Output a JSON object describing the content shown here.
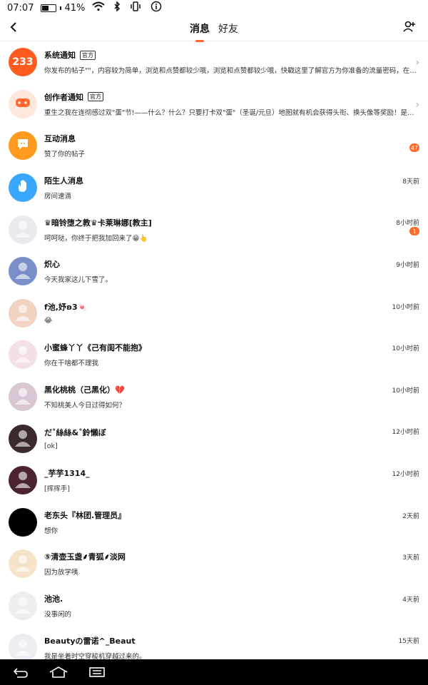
{
  "status": {
    "time": "07:07",
    "battery": "41%",
    "battery_level": 0.41
  },
  "header": {
    "tabs": [
      {
        "label": "消息"
      },
      {
        "label": "好友"
      }
    ]
  },
  "items": [
    {
      "name": "系统通知",
      "tag": "官方",
      "msg": "你发布的帖子\"\"，内容较为简单，浏览和点赞都较少哦，浏览和点赞都较少哦，快戳这里了解官方为你准备的流量密码，在成为...",
      "time": "",
      "badge": "",
      "chevron": true,
      "avatar": "233",
      "color": "#ff5b1f"
    },
    {
      "name": "创作者通知",
      "tag": "官方",
      "msg": "重生之我在连彻感过双\"蛋\"节!——什么？什么？只要打卡双\"蛋\"（圣诞/元旦）地图就有机会获得头衔、换头像等奖励！是推心动...",
      "time": "",
      "badge": "",
      "chevron": true,
      "avatar": "gamepad",
      "color": "#ffe7dc"
    },
    {
      "name": "互动消息",
      "tag": "",
      "msg": "赞了你的帖子",
      "time": "",
      "badge": "47",
      "chevron": false,
      "avatar": "chat",
      "color": "#ff9a1f"
    },
    {
      "name": "陌生人消息",
      "tag": "",
      "msg": "房间速滴",
      "time": "8天前",
      "badge": "",
      "chevron": false,
      "avatar": "hand",
      "color": "#3aa7ff"
    },
    {
      "name": "♛暗铃堕之教♛卡莱琳娜[教主]",
      "tag": "",
      "msg": "呵呵哒，你终于把我加回来了😁👆",
      "time": "8小时前",
      "badge": "1",
      "chevron": false,
      "avatar": "user",
      "color": "#e9e9ef"
    },
    {
      "name": "炽心",
      "tag": "",
      "msg": "今天我家这儿下雪了。",
      "time": "9小时前",
      "badge": "",
      "chevron": false,
      "avatar": "user",
      "color": "#7a8fc7"
    },
    {
      "name": "f池,妤ʚ3🍬",
      "tag": "",
      "msg": "😂",
      "time": "10小时前",
      "badge": "",
      "chevron": false,
      "avatar": "user",
      "color": "#f2d2c2"
    },
    {
      "name": "小蜜蜂丫丫《己有闺不能抱》",
      "tag": "",
      "msg": "你在干啥都不理我",
      "time": "10小时前",
      "badge": "",
      "chevron": false,
      "avatar": "user",
      "color": "#f3dfe6"
    },
    {
      "name": "黑化桃桃（己黑化）💔",
      "tag": "",
      "msg": "不知桃美人今日过得如何？",
      "time": "10小时前",
      "badge": "",
      "chevron": false,
      "avatar": "user",
      "color": "#d9c6d4"
    },
    {
      "name": "だ˚絲絲&˚鈴懶ぼ",
      "tag": "",
      "msg": "[ok]",
      "time": "12小时前",
      "badge": "",
      "chevron": false,
      "avatar": "user",
      "color": "#3b2a2a"
    },
    {
      "name": "_芋芋1314_",
      "tag": "",
      "msg": "[挥挥手]",
      "time": "12小时前",
      "badge": "",
      "chevron": false,
      "avatar": "user",
      "color": "#4c2430"
    },
    {
      "name": "老东头『林团.管理员』",
      "tag": "",
      "msg": "想你",
      "time": "2天前",
      "badge": "",
      "chevron": false,
      "avatar": "dark",
      "color": "#000000"
    },
    {
      "name": "⑤清壶玉盏⸙青狐⸙淡网",
      "tag": "",
      "msg": "因为放学咦",
      "time": "3天前",
      "badge": "",
      "chevron": false,
      "avatar": "user",
      "color": "#f6e3c9"
    },
    {
      "name": "池池.",
      "tag": "",
      "msg": "没事闲的",
      "time": "4天前",
      "badge": "",
      "chevron": false,
      "avatar": "user",
      "color": "#eeeeee"
    },
    {
      "name": "Beautyの雷诺^_Beaut",
      "tag": "",
      "msg": "我是坐着时空穿梭机穿越过来的。",
      "time": "15天前",
      "badge": "",
      "chevron": false,
      "avatar": "user",
      "color": "#ececf2"
    }
  ],
  "icons": {
    "back": "back-arrow-icon",
    "add": "add-friend-icon",
    "nav_back": "nav-back-icon",
    "nav_home": "nav-home-icon",
    "nav_menu": "nav-menu-icon"
  }
}
